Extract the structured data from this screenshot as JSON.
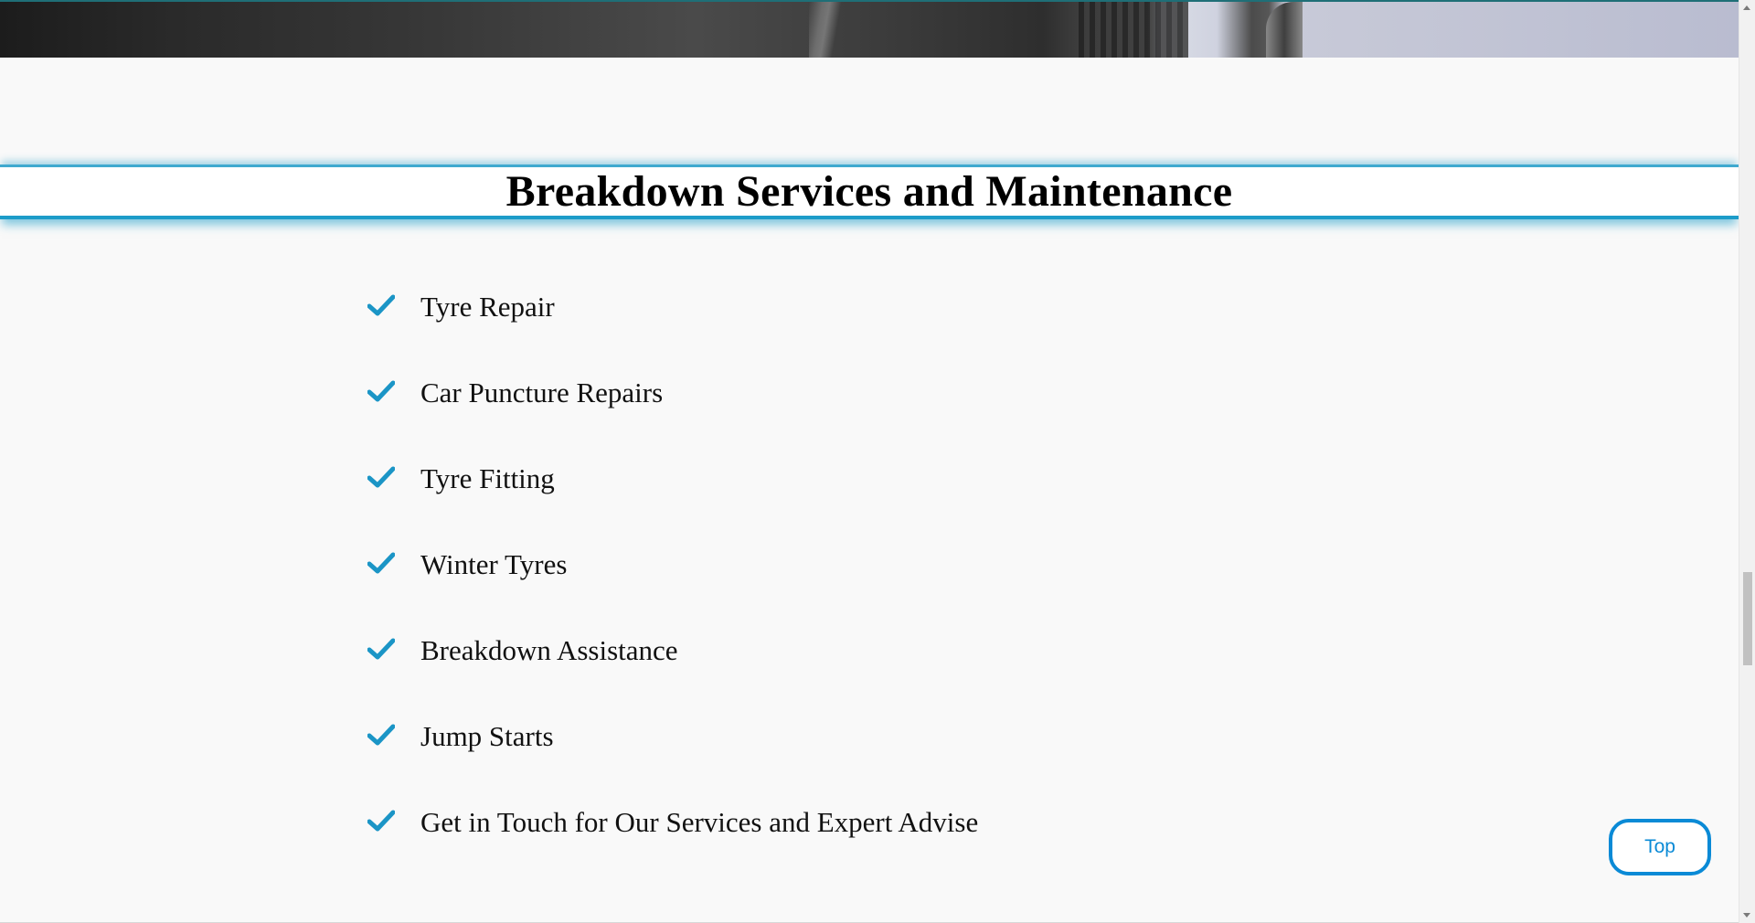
{
  "section": {
    "title": "Breakdown Services and Maintenance",
    "accent_color": "#1c9cc9"
  },
  "services": [
    {
      "label": "Tyre Repair",
      "icon": "check-icon"
    },
    {
      "label": "Car Puncture Repairs",
      "icon": "check-icon"
    },
    {
      "label": "Tyre Fitting",
      "icon": "check-icon"
    },
    {
      "label": "Winter Tyres",
      "icon": "check-icon"
    },
    {
      "label": "Breakdown Assistance",
      "icon": "check-icon"
    },
    {
      "label": "Jump Starts",
      "icon": "check-icon"
    },
    {
      "label": "Get in Touch for Our Services and Expert Advise",
      "icon": "check-icon"
    }
  ],
  "top_button": {
    "label": "Top",
    "color": "#0a8ad6"
  },
  "check_color": "#1b95c6"
}
